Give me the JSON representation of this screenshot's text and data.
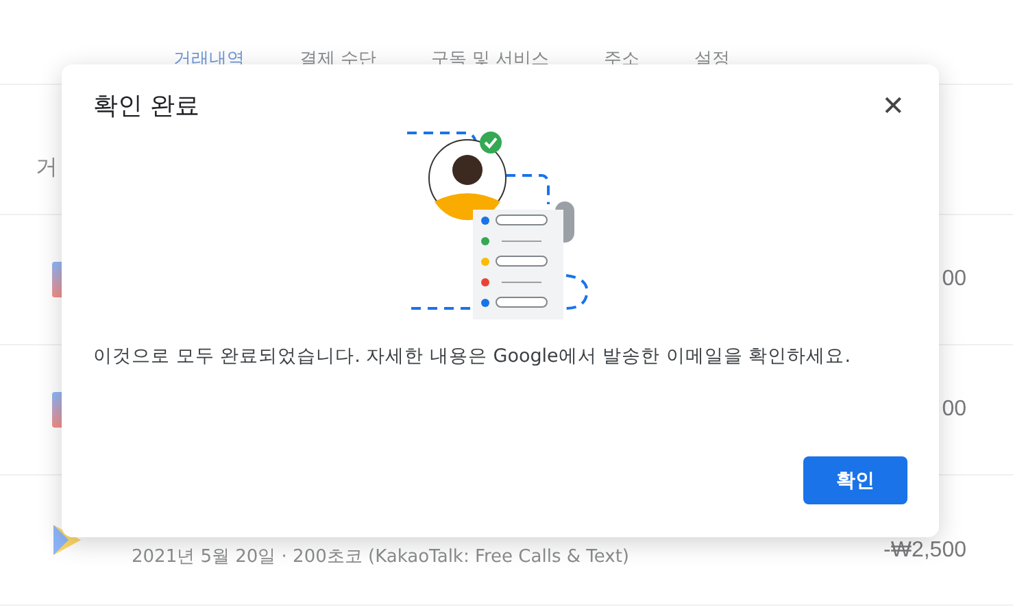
{
  "nav_tabs": [
    {
      "label": "거래내역",
      "selected": true
    },
    {
      "label": "결제 수단",
      "selected": false
    },
    {
      "label": "구독 및 서비스",
      "selected": false
    },
    {
      "label": "주소",
      "selected": false
    },
    {
      "label": "설정",
      "selected": false
    }
  ],
  "section_heading": "거",
  "transactions": [
    {
      "kind": "app",
      "amount": "00"
    },
    {
      "kind": "app",
      "amount": "00"
    },
    {
      "kind": "play",
      "detail": "2021년 5월 20일 · 200초코 (KakaoTalk: Free Calls & Text)",
      "amount": "-₩2,500"
    }
  ],
  "dialog": {
    "title": "확인 완료",
    "close_icon": "✕",
    "message": "이것으로 모두 완료되었습니다. 자세한 내용은 Google에서 발송한 이메일을 확인하세요.",
    "confirm_button": "확인"
  }
}
